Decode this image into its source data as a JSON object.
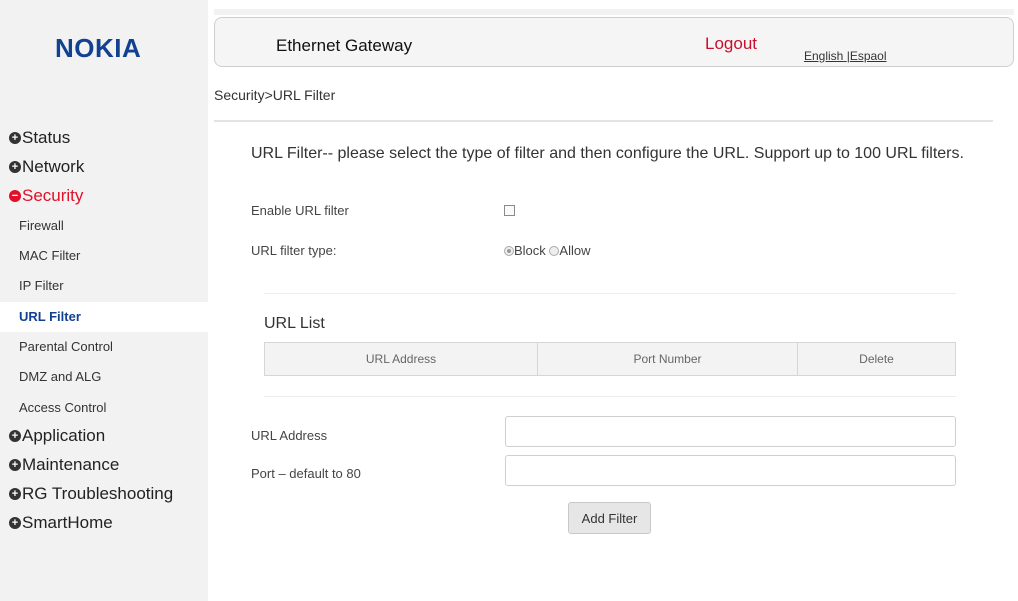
{
  "brand": {
    "logo": "NOKIA"
  },
  "header": {
    "title": "Ethernet Gateway",
    "logout": "Logout",
    "lang_english": "English",
    "lang_sep": "|",
    "lang_espanol": "Espaol"
  },
  "breadcrumb": "Security>URL Filter",
  "sidebar": {
    "items": [
      {
        "label": "Status",
        "icon": "plus-circle-icon"
      },
      {
        "label": "Network",
        "icon": "plus-circle-icon"
      },
      {
        "label": "Security",
        "icon": "minus-circle-icon",
        "active": true
      },
      {
        "label": "Firewall"
      },
      {
        "label": "MAC Filter"
      },
      {
        "label": "IP Filter"
      },
      {
        "label": "URL Filter",
        "selected": true
      },
      {
        "label": "Parental Control"
      },
      {
        "label": "DMZ and ALG"
      },
      {
        "label": "Access Control"
      },
      {
        "label": "Application",
        "icon": "plus-circle-icon"
      },
      {
        "label": "Maintenance",
        "icon": "plus-circle-icon"
      },
      {
        "label": "RG Troubleshooting",
        "icon": "plus-circle-icon"
      },
      {
        "label": "SmartHome",
        "icon": "plus-circle-icon"
      }
    ]
  },
  "main": {
    "description": "URL Filter-- please select the type of filter and then configure the URL. Support up to 100 URL filters.",
    "enable_label": "Enable URL filter",
    "enable_checked": false,
    "type_label": "URL filter type:",
    "type_options": [
      "Block",
      "Allow"
    ],
    "type_selected": "Block",
    "list_title": "URL List",
    "table_headers": [
      "URL Address",
      "Port Number",
      "Delete"
    ],
    "url_label": "URL Address",
    "url_value": "",
    "port_label": "Port – default to 80",
    "port_value": "",
    "add_button": "Add Filter"
  },
  "colors": {
    "brand_blue": "#124191",
    "active_red": "#e0102a",
    "logout_red": "#c8102e"
  }
}
